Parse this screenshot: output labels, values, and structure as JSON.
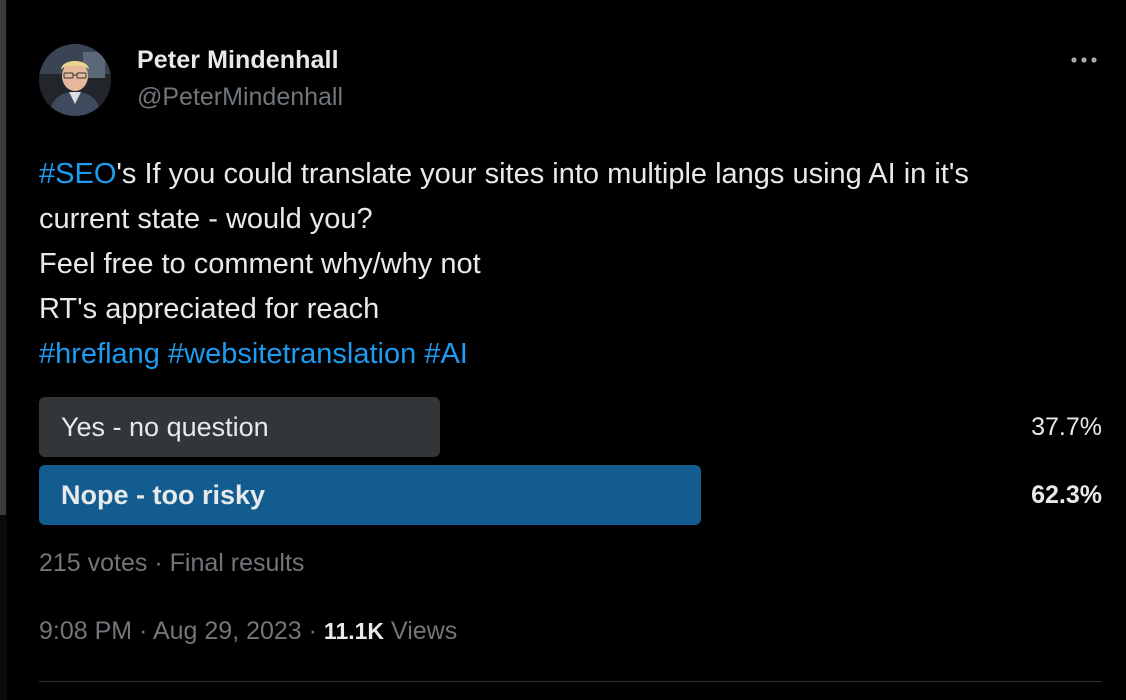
{
  "tweet": {
    "author": {
      "name": "Peter Mindenhall",
      "handle": "@PeterMindenhall",
      "avatar_icon": "profile-photo"
    },
    "more_icon": "more-horizontal-icon",
    "text_lines": [
      [
        {
          "type": "hashtag",
          "text": "#SEO"
        },
        {
          "type": "text",
          "text": "'s If you could translate your sites into multiple langs using AI in it's"
        }
      ],
      [
        {
          "type": "text",
          "text": "current state - would you?"
        }
      ],
      [
        {
          "type": "text",
          "text": "Feel free to comment why/why not"
        }
      ],
      [
        {
          "type": "text",
          "text": "RT's appreciated for reach"
        }
      ],
      [
        {
          "type": "hashtag",
          "text": "#hreflang"
        },
        {
          "type": "text",
          "text": " "
        },
        {
          "type": "hashtag",
          "text": "#websitetranslation"
        },
        {
          "type": "text",
          "text": " "
        },
        {
          "type": "hashtag",
          "text": "#AI"
        }
      ]
    ],
    "poll": {
      "options": [
        {
          "label": "Yes - no question",
          "percent_text": "37.7%",
          "fraction": 0.377,
          "winner": false
        },
        {
          "label": "Nope - too risky",
          "percent_text": "62.3%",
          "fraction": 0.623,
          "winner": true
        }
      ],
      "votes": "215 votes",
      "separator": " · ",
      "status": "Final results"
    },
    "meta": {
      "time": "9:08 PM",
      "separator": " · ",
      "date": "Aug 29, 2023",
      "views_count": "11.1K",
      "views_label": " Views"
    }
  },
  "colors": {
    "background": "#000000",
    "text": "#e7e9ea",
    "secondary_text": "#71767b",
    "hashtag": "#1d9bf0",
    "poll_bar": "#333639",
    "poll_bar_winner": "#135c90"
  }
}
